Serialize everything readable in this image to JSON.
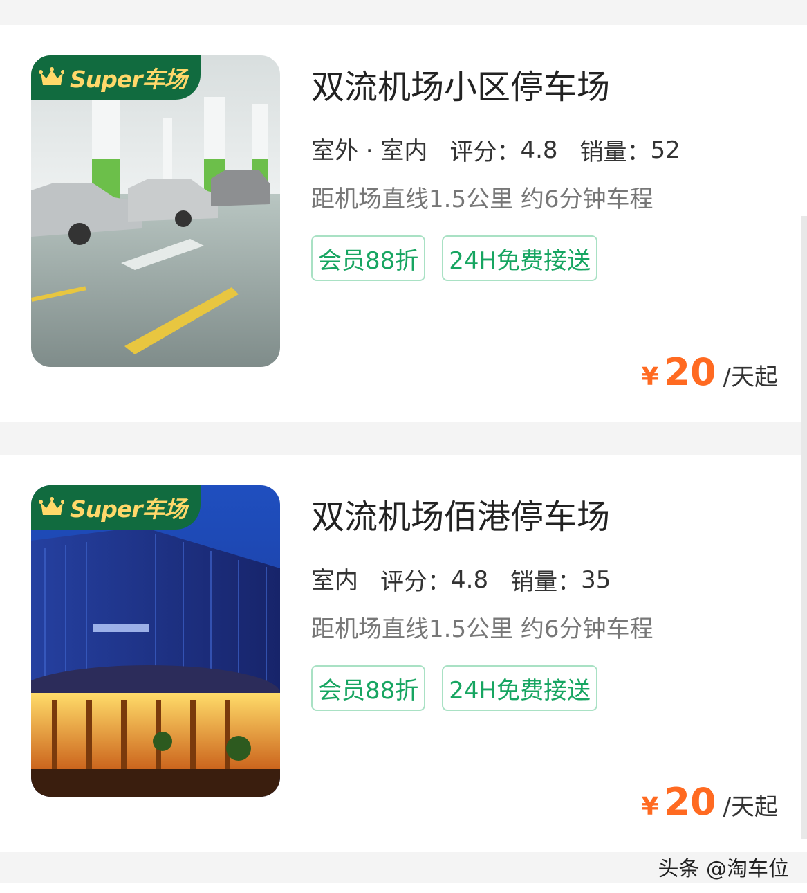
{
  "badge_text": "Super车场",
  "listings": [
    {
      "title": "双流机场小区停车场",
      "type": "室外 · 室内",
      "rating_label": "评分：",
      "rating": "4.8",
      "sales_label": "销量：",
      "sales": "52",
      "distance": "距机场直线1.5公里 约6分钟车程",
      "tags": [
        "会员88折",
        "24H免费接送"
      ],
      "currency": "¥",
      "price": "20",
      "unit": "/天起"
    },
    {
      "title": "双流机场佰港停车场",
      "type": "室内",
      "rating_label": "评分：",
      "rating": "4.8",
      "sales_label": "销量：",
      "sales": "35",
      "distance": "距机场直线1.5公里 约6分钟车程",
      "tags": [
        "会员88折",
        "24H免费接送"
      ],
      "currency": "¥",
      "price": "20",
      "unit": "/天起"
    }
  ],
  "watermark": "头条 @淘车位",
  "colors": {
    "brand_green": "#116b3f",
    "tag_green": "#17a561",
    "price_orange": "#ff6a21"
  }
}
